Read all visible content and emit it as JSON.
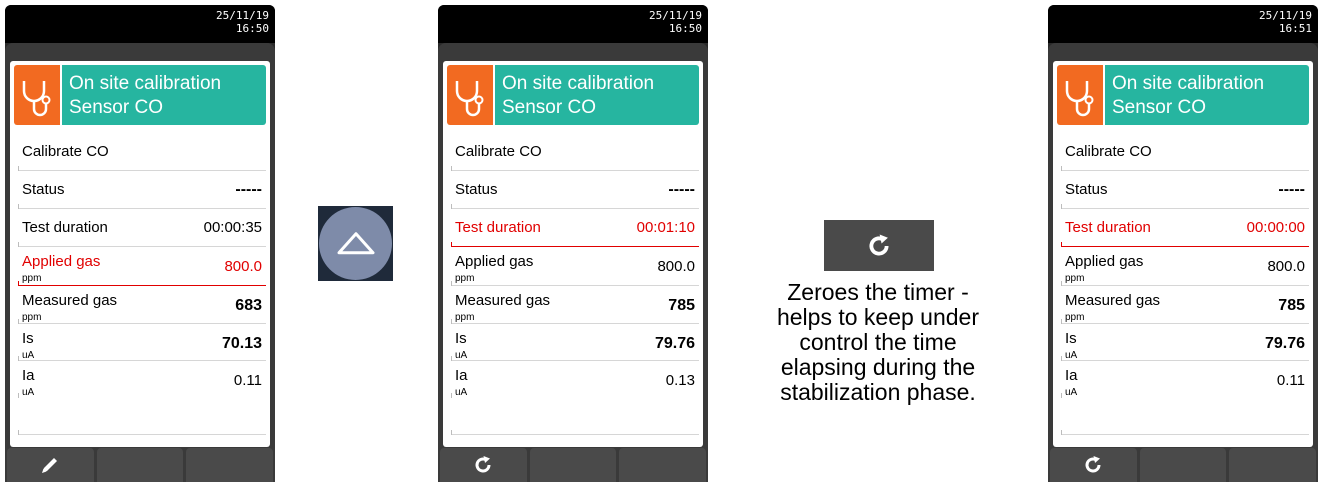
{
  "header": {
    "title_line1": "On site calibration",
    "title_line2": "Sensor CO"
  },
  "panels": [
    {
      "date": "25/11/19",
      "time": "16:50",
      "rows": {
        "calibrate": {
          "label": "Calibrate CO"
        },
        "status": {
          "label": "Status",
          "value": "-----"
        },
        "test_duration": {
          "label": "Test duration",
          "value": "00:00:35"
        },
        "applied_gas": {
          "label": "Applied gas",
          "unit": "ppm",
          "value": "800.0"
        },
        "measured_gas": {
          "label": "Measured gas",
          "unit": "ppm",
          "value": "683"
        },
        "is": {
          "label": "Is",
          "unit": "uA",
          "value": "70.13"
        },
        "ia": {
          "label": "Ia",
          "unit": "uA",
          "value": "0.11"
        }
      },
      "footer_first_icon": "pencil-icon"
    },
    {
      "date": "25/11/19",
      "time": "16:50",
      "rows": {
        "calibrate": {
          "label": "Calibrate CO"
        },
        "status": {
          "label": "Status",
          "value": "-----"
        },
        "test_duration": {
          "label": "Test duration",
          "value": "00:01:10"
        },
        "applied_gas": {
          "label": "Applied gas",
          "unit": "ppm",
          "value": "800.0"
        },
        "measured_gas": {
          "label": "Measured gas",
          "unit": "ppm",
          "value": "785"
        },
        "is": {
          "label": "Is",
          "unit": "uA",
          "value": "79.76"
        },
        "ia": {
          "label": "Ia",
          "unit": "uA",
          "value": "0.13"
        }
      },
      "footer_first_icon": "refresh-icon"
    },
    {
      "date": "25/11/19",
      "time": "16:51",
      "rows": {
        "calibrate": {
          "label": "Calibrate CO"
        },
        "status": {
          "label": "Status",
          "value": "-----"
        },
        "test_duration": {
          "label": "Test duration",
          "value": "00:00:00"
        },
        "applied_gas": {
          "label": "Applied gas",
          "unit": "ppm",
          "value": "800.0"
        },
        "measured_gas": {
          "label": "Measured gas",
          "unit": "ppm",
          "value": "785"
        },
        "is": {
          "label": "Is",
          "unit": "uA",
          "value": "79.76"
        },
        "ia": {
          "label": "Ia",
          "unit": "uA",
          "value": "0.11"
        }
      },
      "footer_first_icon": "refresh-icon"
    }
  ],
  "icons": {
    "header": "stethoscope-icon",
    "arrow": "arrow-up-icon",
    "refresh": "refresh-icon"
  },
  "colors": {
    "header_orange": "#f26a21",
    "header_teal": "#26b5a0",
    "highlight_red": "#e10000",
    "up_button": "#7e8ba9"
  },
  "caption": {
    "line1": "Zeroes the timer -",
    "line2": "helps to keep under",
    "line3": "control the time",
    "line4": "elapsing during the",
    "line5": "stabilization phase."
  }
}
